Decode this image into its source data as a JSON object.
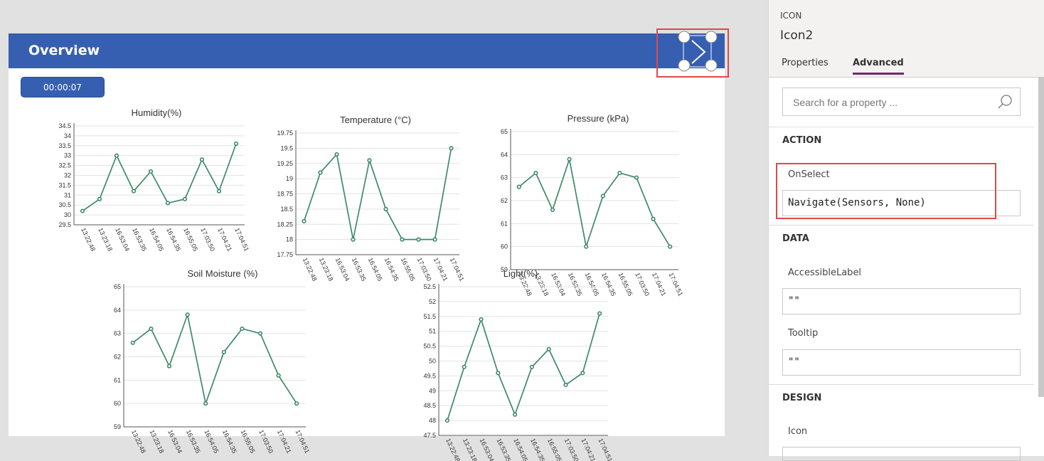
{
  "screen": {
    "header_title": "Overview",
    "timer": "00:00:07"
  },
  "charts": [
    {
      "title": "Humidity(%)",
      "ticks": [
        "29.5",
        "30",
        "30.5",
        "31",
        "31.5",
        "32",
        "32.5",
        "33",
        "33.5",
        "34",
        "34.5"
      ],
      "labels": [
        "13:22:48",
        "13:23:18",
        "16:53:04",
        "16:53:35",
        "16:54:05",
        "16:54:35",
        "16:55:05",
        "17:03:50",
        "17:04:21",
        "17:04:51"
      ]
    },
    {
      "title": "Temperature (°C)",
      "ticks": [
        "17.75",
        "18",
        "18.25",
        "18.5",
        "18.75",
        "19",
        "19.25",
        "19.5",
        "19.75"
      ],
      "labels": [
        "13:22:48",
        "13:23:18",
        "16:53:04",
        "16:53:35",
        "16:54:05",
        "16:54:35",
        "16:55:05",
        "17:03:50",
        "17:04:21",
        "17:04:51"
      ]
    },
    {
      "title": "Pressure (kPa)",
      "ticks": [
        "59",
        "60",
        "61",
        "62",
        "63",
        "64",
        "65"
      ],
      "labels": [
        "13:22:48",
        "13:23:18",
        "16:53:04",
        "16:53:35",
        "16:54:05",
        "16:54:35",
        "16:55:05",
        "17:03:50",
        "17:04:21",
        "17:04:51"
      ]
    },
    {
      "title": "Soil Moisture (%)",
      "ticks": [
        "59",
        "60",
        "61",
        "62",
        "63",
        "64",
        "65"
      ],
      "labels": [
        "13:22:48",
        "13:23:18",
        "16:53:04",
        "16:53:35",
        "16:54:05",
        "16:54:35",
        "16:55:05",
        "17:03:50",
        "17:04:21",
        "17:04:51"
      ]
    },
    {
      "title": "Light(%)",
      "ticks": [
        "47.5",
        "48",
        "48.5",
        "49",
        "49.5",
        "50",
        "50.5",
        "51",
        "51.5",
        "52",
        "52.5"
      ],
      "labels": [
        "13:22:48",
        "13:23:18",
        "16:53:04",
        "16:53:35",
        "16:54:05",
        "16:54:35",
        "16:55:05",
        "17:03:50",
        "17:04:21",
        "17:04:51"
      ]
    }
  ],
  "chart_data": [
    {
      "type": "line",
      "title": "Humidity(%)",
      "x": [
        "13:22:48",
        "13:23:18",
        "16:53:04",
        "16:53:35",
        "16:54:05",
        "16:54:35",
        "16:55:05",
        "17:03:50",
        "17:04:21",
        "17:04:51"
      ],
      "values": [
        30.2,
        30.8,
        33.0,
        31.2,
        32.2,
        30.6,
        30.8,
        32.8,
        31.2,
        33.6
      ],
      "ylim": [
        29.5,
        34.5
      ],
      "color": "#3e8a6a"
    },
    {
      "type": "line",
      "title": "Temperature (°C)",
      "x": [
        "13:22:48",
        "13:23:18",
        "16:53:04",
        "16:53:35",
        "16:54:05",
        "16:54:35",
        "16:55:05",
        "17:03:50",
        "17:04:21",
        "17:04:51"
      ],
      "values": [
        18.3,
        19.1,
        19.4,
        18.0,
        19.3,
        18.5,
        18.0,
        18.0,
        18.0,
        19.5
      ],
      "ylim": [
        17.75,
        19.75
      ],
      "color": "#3e8a6a"
    },
    {
      "type": "line",
      "title": "Pressure (kPa)",
      "x": [
        "13:22:48",
        "13:23:18",
        "16:53:04",
        "16:53:35",
        "16:54:05",
        "16:54:35",
        "16:55:05",
        "17:03:50",
        "17:04:21",
        "17:04:51"
      ],
      "values": [
        62.6,
        63.2,
        61.6,
        63.8,
        60.0,
        62.2,
        63.2,
        63.0,
        61.2,
        60.0
      ],
      "ylim": [
        59,
        65
      ],
      "color": "#3e8a6a"
    },
    {
      "type": "line",
      "title": "Soil Moisture (%)",
      "x": [
        "13:22:48",
        "13:23:18",
        "16:53:04",
        "16:53:35",
        "16:54:05",
        "16:54:35",
        "16:55:05",
        "17:03:50",
        "17:04:21",
        "17:04:51"
      ],
      "values": [
        62.6,
        63.2,
        61.6,
        63.8,
        60.0,
        62.2,
        63.2,
        63.0,
        61.2,
        60.0
      ],
      "ylim": [
        59,
        65
      ],
      "color": "#3e8a6a"
    },
    {
      "type": "line",
      "title": "Light(%)",
      "x": [
        "13:22:48",
        "13:23:18",
        "16:53:04",
        "16:53:35",
        "16:54:05",
        "16:54:35",
        "16:55:05",
        "17:03:50",
        "17:04:21",
        "17:04:51"
      ],
      "values": [
        48.0,
        49.8,
        51.4,
        49.6,
        48.2,
        49.8,
        50.4,
        49.2,
        49.6,
        51.6
      ],
      "ylim": [
        47.5,
        52.5
      ],
      "color": "#3e8a6a"
    }
  ],
  "panel": {
    "control_type": "ICON",
    "control_name": "Icon2",
    "tabs": {
      "properties": "Properties",
      "advanced": "Advanced"
    },
    "search_placeholder": "Search for a property ...",
    "sections": {
      "action": "ACTION",
      "data": "DATA",
      "design": "DESIGN"
    },
    "onselect_label": "OnSelect",
    "onselect_value": "Navigate(Sensors, None)",
    "accessible_label": "AccessibleLabel",
    "accessible_value": "\"\"",
    "tooltip_label": "Tooltip",
    "tooltip_value": "\"\"",
    "icon_label": "Icon"
  },
  "colors": {
    "header": "#365fb1",
    "accent": "#742774",
    "line": "#3e8a6a",
    "highlight": "#e0484a"
  }
}
